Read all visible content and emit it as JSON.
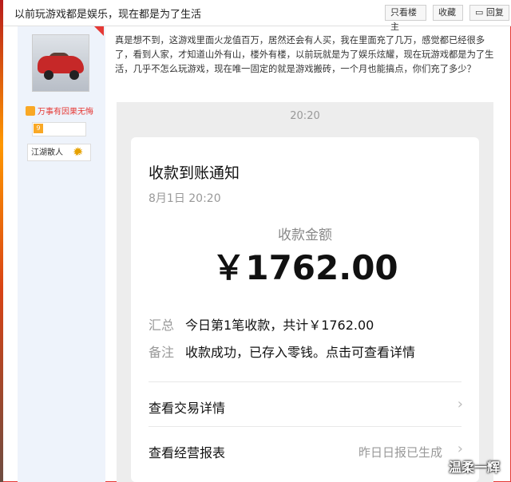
{
  "topbar": {
    "title": "以前玩游戏都是娱乐，现在都是为了生活",
    "only_op": "只看楼主",
    "favorite": "收藏",
    "reply": "回复"
  },
  "user": {
    "motto": "万事有因果无悔",
    "level_badge": "9",
    "rank": "江湖散人",
    "rank_num": "6"
  },
  "post": {
    "body": "真是想不到，这游戏里面火龙值百万，居然还会有人买，我在里面充了几万，感觉都已经很多了，看到人家，才知道山外有山，楼外有楼，以前玩就是为了娱乐炫耀，现在玩游戏都是为了生活，几乎不怎么玩游戏，现在唯一固定的就是游戏搬砖，一个月也能搞点，你们充了多少？"
  },
  "phone": {
    "time": "20:20",
    "card_title": "收款到账通知",
    "card_date": "8月1日 20:20",
    "amount_label": "收款金额",
    "amount": "￥1762.00",
    "summary_key": "汇总",
    "summary_val": "今日第1笔收款，共计￥1762.00",
    "note_key": "备注",
    "note_val": "收款成功，已存入零钱。点击可查看详情",
    "link1": "查看交易详情",
    "link2": "查看经营报表",
    "link2_hint": "昨日日报已生成"
  },
  "watermark": "温柔一辉"
}
